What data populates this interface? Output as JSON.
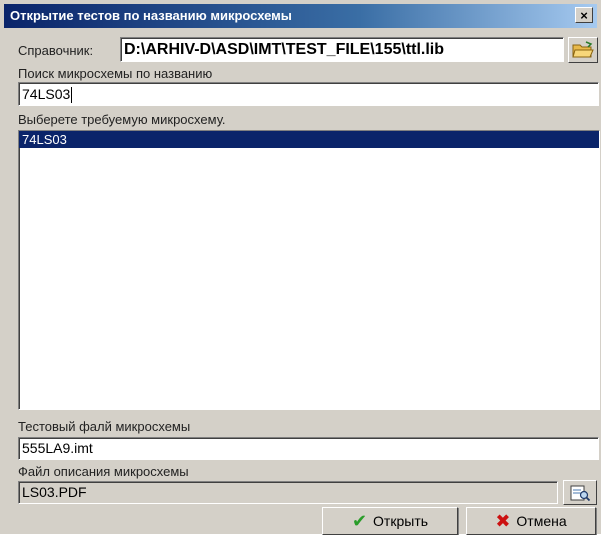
{
  "window": {
    "title": "Открытие тестов по названию микросхемы",
    "close_label": "×"
  },
  "directory": {
    "label": "Справочник:",
    "value": "D:\\ARHIV-D\\ASD\\IMT\\TEST_FILE\\155\\ttl.lib"
  },
  "search": {
    "label": "Поиск микросхемы по названию",
    "value": "74LS03"
  },
  "chip_list": {
    "label": "Выберете требуемую микросхему.",
    "items": [
      "74LS03"
    ],
    "selected_index": 0
  },
  "test_file": {
    "label": "Тестовый фалй микросхемы",
    "value": "555LA9.imt"
  },
  "description_file": {
    "label": "Файл описания микросхемы",
    "value": "LS03.PDF"
  },
  "buttons": {
    "open_label": "Открыть",
    "cancel_label": "Отмена"
  },
  "colors": {
    "selection": "#0a246a",
    "open_icon": "#2a9d2a",
    "cancel_icon": "#cc1111"
  },
  "icons": {
    "browse": "folder-open-icon",
    "view": "document-view-icon",
    "open": "checkmark-icon",
    "cancel": "cross-icon"
  }
}
